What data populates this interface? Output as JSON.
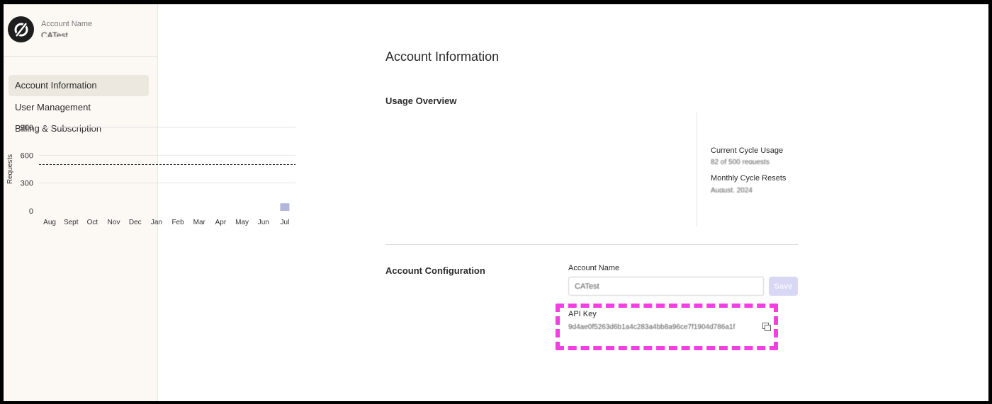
{
  "sidebar": {
    "account_label": "Account Name",
    "account_value": "CATest",
    "items": [
      {
        "label": "Account Information",
        "active": true
      },
      {
        "label": "User Management",
        "active": false
      },
      {
        "label": "Billing & Subscription",
        "active": false
      }
    ]
  },
  "main": {
    "title": "Account Information",
    "usage": {
      "title": "Usage Overview",
      "stats": [
        {
          "label": "Current Cycle Usage",
          "value": "82 of 500 requests"
        },
        {
          "label": "Monthly Cycle Resets",
          "value": "August, 2024"
        }
      ]
    },
    "config": {
      "title": "Account Configuration",
      "name_label": "Account Name",
      "name_value": "CATest",
      "save_label": "Save",
      "api_label": "API Key",
      "api_value": "9d4ae0f5263d6b1a4c283a4bb8a96ce7f1904d786a1f"
    }
  },
  "chart_data": {
    "type": "bar",
    "ylabel": "Requests",
    "xlabel": "",
    "categories": [
      "Aug",
      "Sept",
      "Oct",
      "Nov",
      "Dec",
      "Jan",
      "Feb",
      "Mar",
      "Apr",
      "May",
      "Jun",
      "Jul"
    ],
    "values": [
      0,
      0,
      0,
      0,
      0,
      0,
      0,
      0,
      0,
      0,
      0,
      82
    ],
    "ylim": [
      0,
      900
    ],
    "yticks": [
      0,
      300,
      600,
      900
    ],
    "limit_line": 500,
    "grid": true,
    "bar_color": "#b3b6dc"
  },
  "colors": {
    "accent_highlight": "#f23ee3",
    "save_disabled": "#d8d8f4",
    "sidebar_bg": "#fcf8f4",
    "nav_active_bg": "#ede8df"
  },
  "icons": {
    "logo": "slashed-circle-logo-icon",
    "copy": "copy-icon"
  }
}
